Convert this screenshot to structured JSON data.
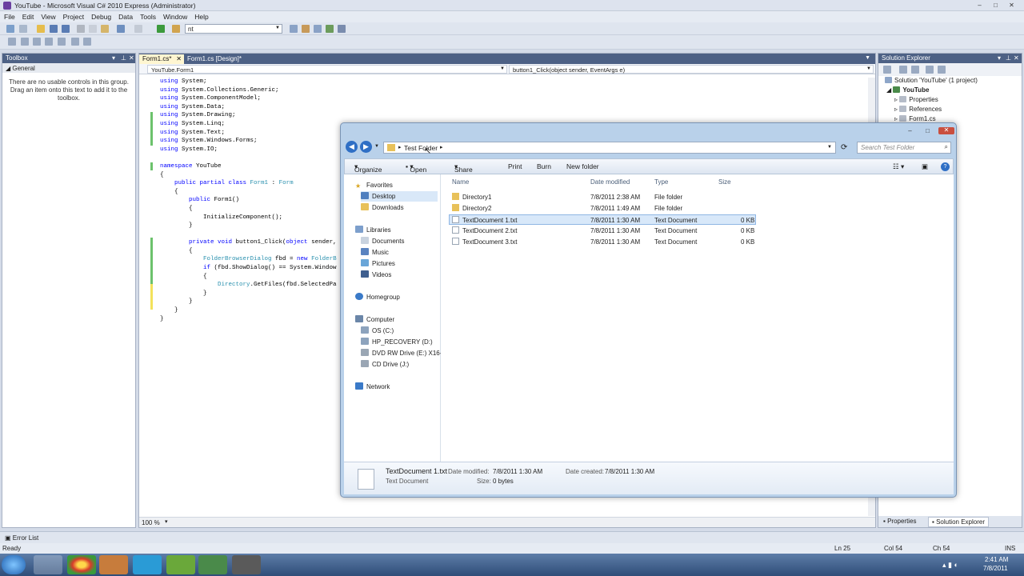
{
  "window": {
    "title": "YouTube - Microsoft Visual C# 2010 Express (Administrator)"
  },
  "menu": [
    "File",
    "Edit",
    "View",
    "Project",
    "Debug",
    "Data",
    "Tools",
    "Window",
    "Help"
  ],
  "toolbar": {
    "find_combo_value": "nt"
  },
  "toolbox": {
    "title": "Toolbox",
    "group": "General",
    "message": "There are no usable controls in this group. Drag an item onto this text to add it to the toolbox."
  },
  "editor": {
    "tabs": [
      "Form1.cs*",
      "Form1.cs [Design]*"
    ],
    "nav_left": "YouTube.Form1",
    "nav_right": "button1_Click(object sender, EventArgs e)",
    "lines": [
      "using System;",
      "using System.Collections.Generic;",
      "using System.ComponentModel;",
      "using System.Data;",
      "using System.Drawing;",
      "using System.Linq;",
      "using System.Text;",
      "using System.Windows.Forms;",
      "using System.IO;",
      "",
      "namespace YouTube",
      "{",
      "    public partial class Form1 : Form",
      "    {",
      "        public Form1()",
      "        {",
      "            InitializeComponent();",
      "        }",
      "",
      "        private void button1_Click(object sender,",
      "        {",
      "            FolderBrowserDialog fbd = new FolderB",
      "            if (fbd.ShowDialog() == System.Window",
      "            {",
      "                Directory.GetFiles(fbd.SelectedPa",
      "            }",
      "        }",
      "    }",
      "}"
    ],
    "zoom": "100 %"
  },
  "solution_explorer": {
    "title": "Solution Explorer",
    "items": [
      "Solution 'YouTube' (1 project)",
      "YouTube",
      "Properties",
      "References",
      "Form1.cs"
    ],
    "bottom_tabs": [
      "Properties",
      "Solution Explorer"
    ]
  },
  "explorer": {
    "breadcrumb": "Test Folder",
    "search_placeholder": "Search Test Folder",
    "commands": [
      "Organize",
      "Open",
      "Share with",
      "Print",
      "Burn",
      "New folder"
    ],
    "nav": {
      "favorites": "Favorites",
      "favorites_items": [
        "Desktop",
        "Downloads"
      ],
      "libraries": "Libraries",
      "libraries_items": [
        "Documents",
        "Music",
        "Pictures",
        "Videos"
      ],
      "homegroup": "Homegroup",
      "computer": "Computer",
      "computer_items": [
        "OS (C:)",
        "HP_RECOVERY (D:)",
        "DVD RW Drive (E:) X16-8",
        "CD Drive (J:)"
      ],
      "network": "Network"
    },
    "columns": [
      "Name",
      "Date modified",
      "Type",
      "Size"
    ],
    "files": [
      {
        "name": "Directory1",
        "date": "7/8/2011 2:38 AM",
        "type": "File folder",
        "size": ""
      },
      {
        "name": "Directory2",
        "date": "7/8/2011 1:49 AM",
        "type": "File folder",
        "size": ""
      },
      {
        "name": "TextDocument 1.txt",
        "date": "7/8/2011 1:30 AM",
        "type": "Text Document",
        "size": "0 KB"
      },
      {
        "name": "TextDocument 2.txt",
        "date": "7/8/2011 1:30 AM",
        "type": "Text Document",
        "size": "0 KB"
      },
      {
        "name": "TextDocument 3.txt",
        "date": "7/8/2011 1:30 AM",
        "type": "Text Document",
        "size": "0 KB"
      }
    ],
    "details": {
      "name": "TextDocument 1.txt",
      "type": "Text Document",
      "modified_label": "Date modified:",
      "modified": "7/8/2011 1:30 AM",
      "created_label": "Date created:",
      "created": "7/8/2011 1:30 AM",
      "size_label": "Size:",
      "size": "0 bytes"
    }
  },
  "errorlist": {
    "label": "Error List"
  },
  "status": {
    "ready": "Ready",
    "ln": "Ln 25",
    "col": "Col 54",
    "ch": "Ch 54",
    "ins": "INS"
  },
  "taskbar": {
    "time": "2:41 AM",
    "date": "7/8/2011"
  }
}
